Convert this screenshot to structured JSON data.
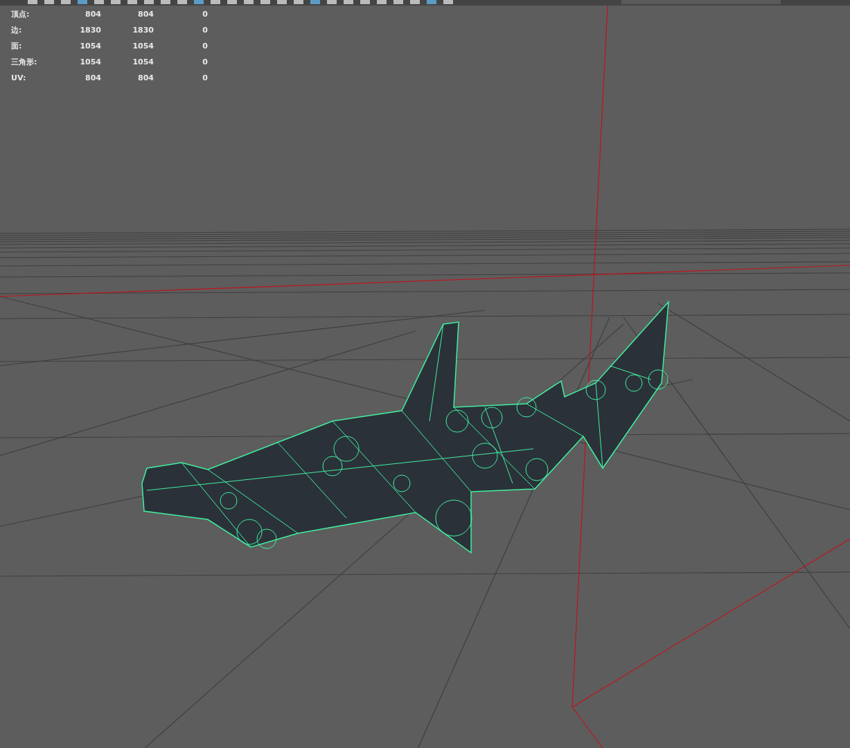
{
  "stats": [
    {
      "label": "顶点:",
      "column_1": "804",
      "column_2": "804",
      "column_3": "0"
    },
    {
      "label": "边:",
      "column_1": "1830",
      "column_2": "1830",
      "column_3": "0"
    },
    {
      "label": "面:",
      "column_1": "1054",
      "column_2": "1054",
      "column_3": "0"
    },
    {
      "label": "三角形:",
      "column_1": "1054",
      "column_2": "1054",
      "column_3": "0"
    },
    {
      "label": "UV:",
      "column_1": "804",
      "column_2": "804",
      "column_3": "0"
    }
  ]
}
